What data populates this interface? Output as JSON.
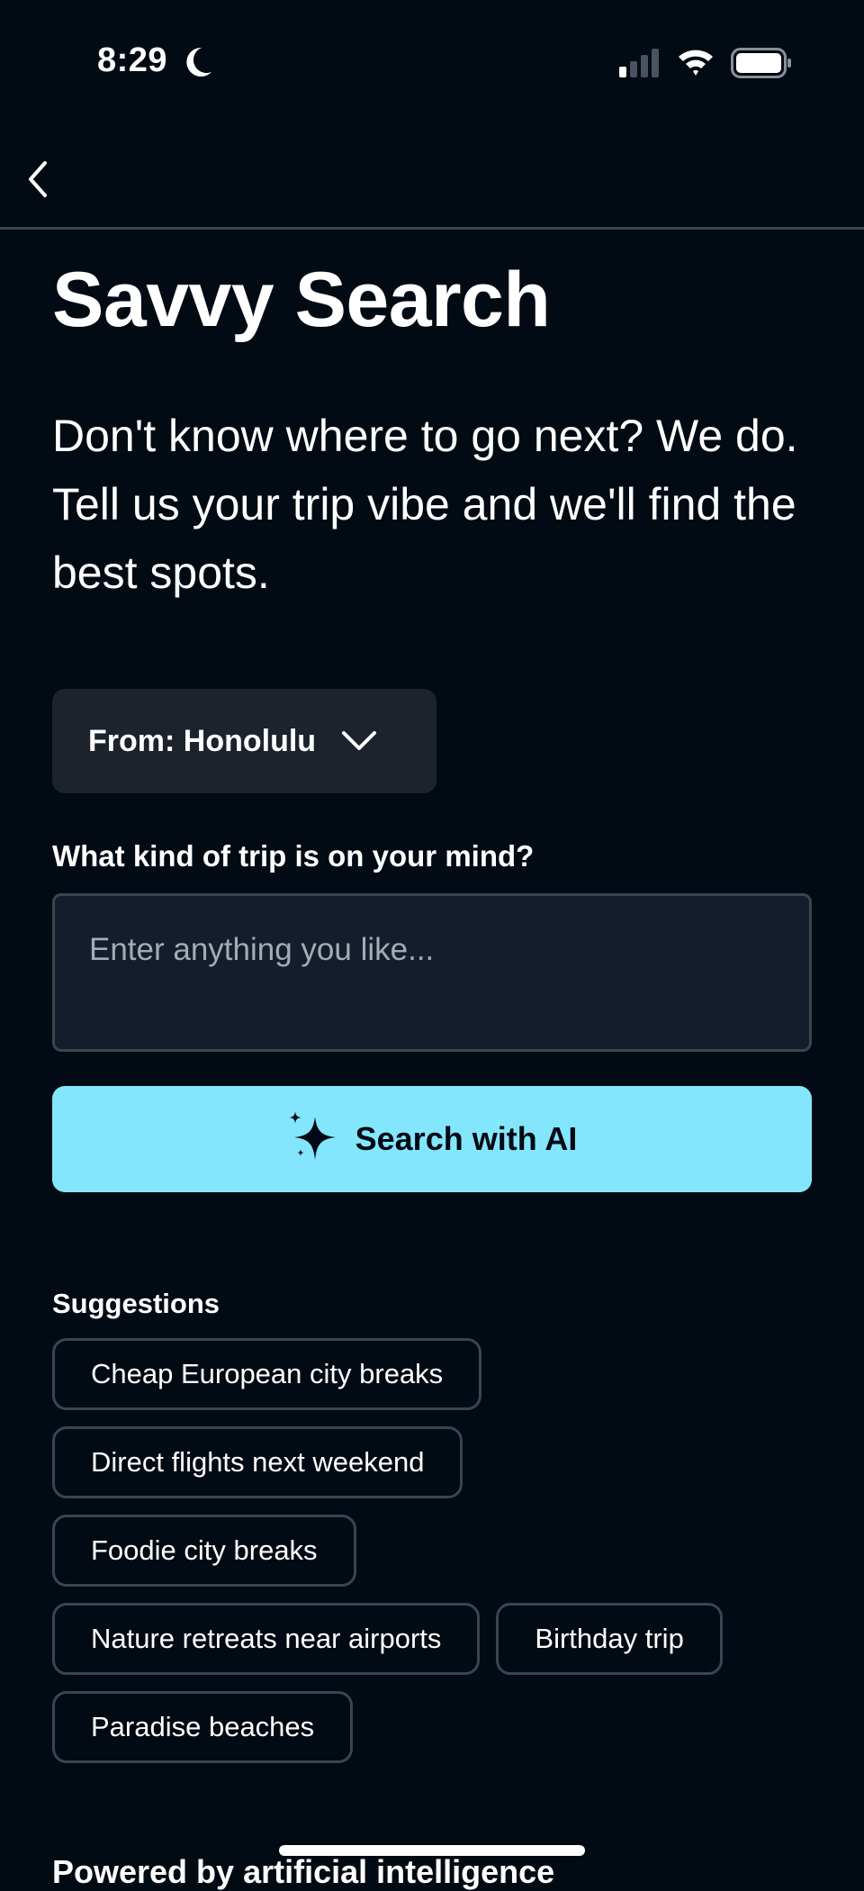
{
  "status_bar": {
    "time": "8:29",
    "icons": [
      "moon-icon",
      "signal-icon",
      "wifi-icon",
      "battery-icon"
    ]
  },
  "nav": {
    "back_icon": "chevron-left-icon"
  },
  "header": {
    "title": "Savvy Search",
    "subtitle": "Don't know where to go next? We do. Tell us your trip vibe and we'll find the best spots."
  },
  "origin": {
    "label": "From: Honolulu",
    "icon": "chevron-down-icon"
  },
  "trip_query": {
    "label": "What kind of trip is on your mind?",
    "value": "",
    "placeholder": "Enter anything you like..."
  },
  "search_button": {
    "label": "Search with AI",
    "icon": "sparkles-icon",
    "color": "#84e6fd"
  },
  "suggestions": {
    "title": "Suggestions",
    "rows": [
      [
        "Cheap European city breaks"
      ],
      [
        "Direct flights next weekend"
      ],
      [
        "Foodie city breaks"
      ],
      [
        "Nature retreats near airports",
        "Birthday trip"
      ],
      [
        "Paradise beaches"
      ]
    ]
  },
  "footer": {
    "text": "Powered by artificial intelligence"
  },
  "colors": {
    "background": "#020a13",
    "accent": "#84e6fd",
    "border": "#3a4453",
    "surface": "#1c232d"
  }
}
